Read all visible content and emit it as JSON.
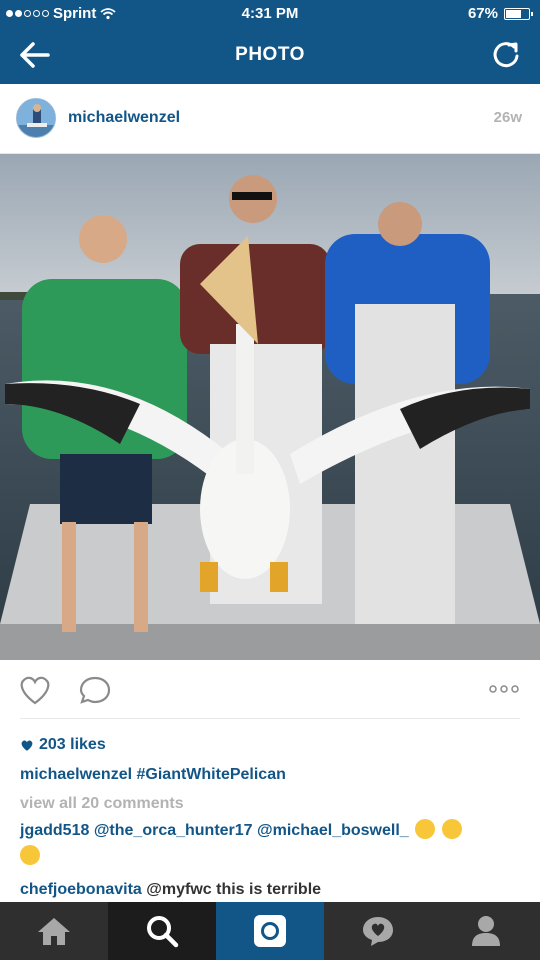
{
  "status_bar": {
    "carrier": "Sprint",
    "time": "4:31 PM",
    "battery": "67%",
    "battery_level": 0.67
  },
  "nav": {
    "title": "PHOTO",
    "back_icon": "back-arrow-icon",
    "refresh_icon": "refresh-icon"
  },
  "post": {
    "username": "michaelwenzel",
    "age": "26w",
    "likes": "203 likes",
    "caption": {
      "user": "michaelwenzel",
      "text": "#GiantWhitePelican"
    },
    "view_all": "view all 20 comments",
    "comments": [
      {
        "user": "jgadd518",
        "text": "@the_orca_hunter17 @michael_boswell_"
      },
      {
        "user": "chefjoebonavita",
        "text": "@myfwc this is terrible"
      }
    ]
  },
  "tabbar": {
    "items": [
      "home-icon",
      "search-icon",
      "camera-icon",
      "activity-icon",
      "profile-icon"
    ],
    "active": 2
  },
  "colors": {
    "brand": "#125688",
    "muted": "#b3b3b3",
    "tabbar": "#2f2f2f"
  }
}
